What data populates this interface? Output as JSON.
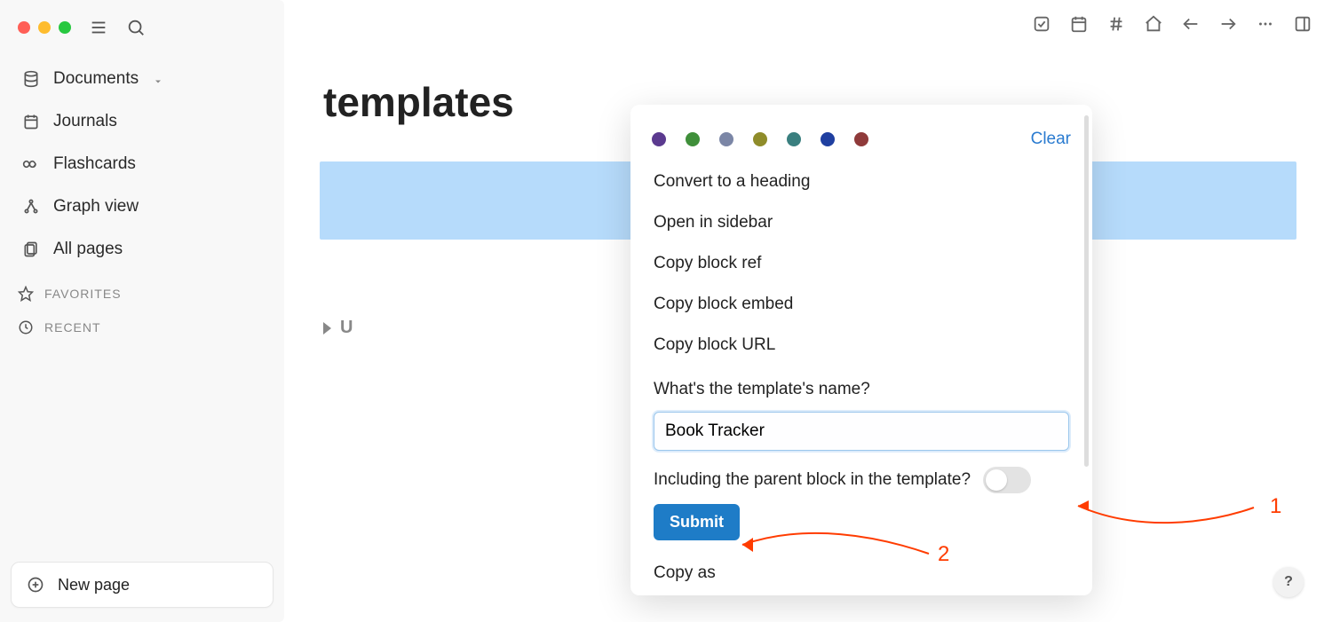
{
  "sidebar": {
    "items": [
      {
        "label": "Documents",
        "icon": "database-icon",
        "caret": true
      },
      {
        "label": "Journals",
        "icon": "calendar-icon"
      },
      {
        "label": "Flashcards",
        "icon": "infinity-icon"
      },
      {
        "label": "Graph view",
        "icon": "graph-icon"
      },
      {
        "label": "All pages",
        "icon": "pages-icon"
      }
    ],
    "favorites_label": "FAVORITES",
    "recent_label": "RECENT",
    "new_page_label": "New page"
  },
  "page": {
    "title": "templates",
    "unlinked_label": "U"
  },
  "popup": {
    "clear_label": "Clear",
    "colors": [
      "#5b3a8f",
      "#3f8f3a",
      "#7b86a6",
      "#8f8c2a",
      "#3a7f7f",
      "#1f3fa0",
      "#8f3a3a"
    ],
    "menu": [
      "Convert to a heading",
      "Open in sidebar",
      "Copy block ref",
      "Copy block embed",
      "Copy block URL"
    ],
    "template_prompt": "What's the template's name?",
    "template_value": "Book Tracker",
    "parent_toggle_label": "Including the parent block in the template?",
    "submit_label": "Submit",
    "copy_as_label": "Copy as"
  },
  "annotations": {
    "one": "1",
    "two": "2"
  },
  "help": "?"
}
